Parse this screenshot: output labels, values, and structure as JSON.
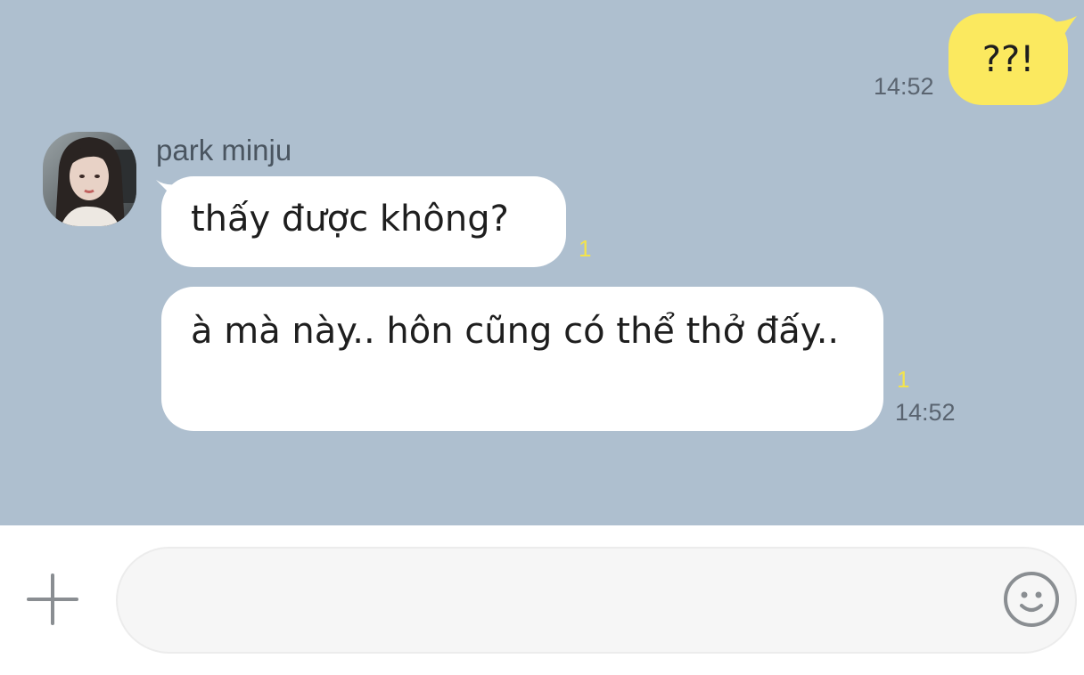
{
  "messages": {
    "outgoing": [
      {
        "text": "??!",
        "time": "14:52"
      }
    ],
    "incoming": {
      "sender": "park minju",
      "avatar_icon": "profile-photo",
      "items": [
        {
          "text": "thấy được không?",
          "unread": "1"
        },
        {
          "text": "à mà này.. hôn cũng có thể thở đấy..",
          "unread": "1",
          "time": "14:52"
        }
      ]
    }
  },
  "composer": {
    "plus_icon": "plus-icon",
    "input_value": "",
    "input_placeholder": "",
    "emoji_icon": "smiley-icon"
  },
  "colors": {
    "chat_background": "#aebfcf",
    "outgoing_bubble": "#fbe95f",
    "incoming_bubble": "#ffffff",
    "unread_count": "#f3e34c",
    "input_field": "#f6f6f6"
  }
}
